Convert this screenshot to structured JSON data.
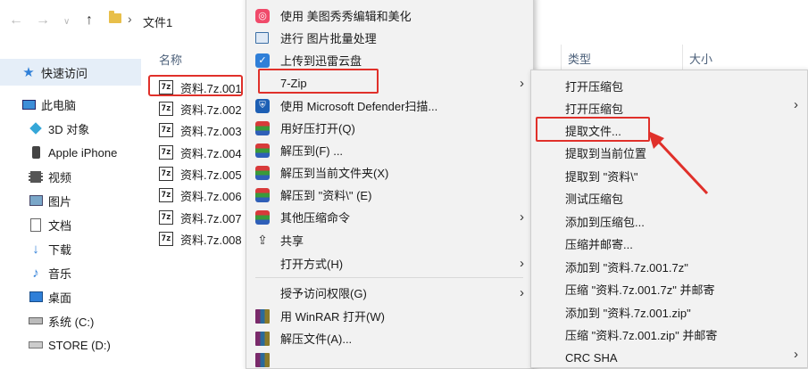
{
  "breadcrumb": {
    "folder": "文件1"
  },
  "sidebar": {
    "quick_access": "快速访问",
    "items": [
      {
        "label": "此电脑",
        "icon": "computer-icon"
      },
      {
        "label": "3D 对象",
        "icon": "3d-objects-icon"
      },
      {
        "label": "Apple iPhone",
        "icon": "phone-icon"
      },
      {
        "label": "视频",
        "icon": "video-icon"
      },
      {
        "label": "图片",
        "icon": "picture-icon"
      },
      {
        "label": "文档",
        "icon": "document-icon"
      },
      {
        "label": "下载",
        "icon": "download-icon"
      },
      {
        "label": "音乐",
        "icon": "music-icon"
      },
      {
        "label": "桌面",
        "icon": "desktop-icon"
      },
      {
        "label": "系统 (C:)",
        "icon": "drive-icon"
      },
      {
        "label": "STORE (D:)",
        "icon": "drive-icon"
      }
    ]
  },
  "file_list": {
    "header_name": "名称",
    "header_type": "类型",
    "header_size": "大小",
    "files": [
      "资料.7z.001",
      "资料.7z.002",
      "资料.7z.003",
      "资料.7z.004",
      "资料.7z.005",
      "资料.7z.006",
      "资料.7z.007",
      "资料.7z.008"
    ],
    "icon_text": "7z"
  },
  "context_menu": {
    "items": [
      {
        "label": "使用 美图秀秀编辑和美化"
      },
      {
        "label": "进行 图片批量处理"
      },
      {
        "label": "上传到迅雷云盘"
      },
      {
        "label": "7-Zip"
      },
      {
        "label": "使用 Microsoft Defender扫描..."
      },
      {
        "label": "用好压打开(Q)"
      },
      {
        "label": "解压到(F) ..."
      },
      {
        "label": "解压到当前文件夹(X)"
      },
      {
        "label": "解压到 \"资料\\\" (E)"
      },
      {
        "label": "其他压缩命令"
      },
      {
        "label": "共享"
      },
      {
        "label": "打开方式(H)"
      },
      {
        "label": "授予访问权限(G)"
      },
      {
        "label": "用 WinRAR 打开(W)"
      },
      {
        "label": "解压文件(A)..."
      }
    ]
  },
  "sub_menu": {
    "items": [
      {
        "label": "打开压缩包"
      },
      {
        "label": "打开压缩包"
      },
      {
        "label": "提取文件..."
      },
      {
        "label": "提取到当前位置"
      },
      {
        "label": "提取到 \"资料\\\""
      },
      {
        "label": "测试压缩包"
      },
      {
        "label": "添加到压缩包..."
      },
      {
        "label": "压缩并邮寄..."
      },
      {
        "label": "添加到 \"资料.7z.001.7z\""
      },
      {
        "label": "压缩 \"资料.7z.001.7z\" 并邮寄"
      },
      {
        "label": "添加到 \"资料.7z.001.zip\""
      },
      {
        "label": "压缩 \"资料.7z.001.zip\" 并邮寄"
      },
      {
        "label": "CRC SHA"
      }
    ]
  },
  "colors": {
    "highlight": "#e0302a",
    "menu_bg": "#f2f2f2",
    "selection": "#e5eef8"
  }
}
